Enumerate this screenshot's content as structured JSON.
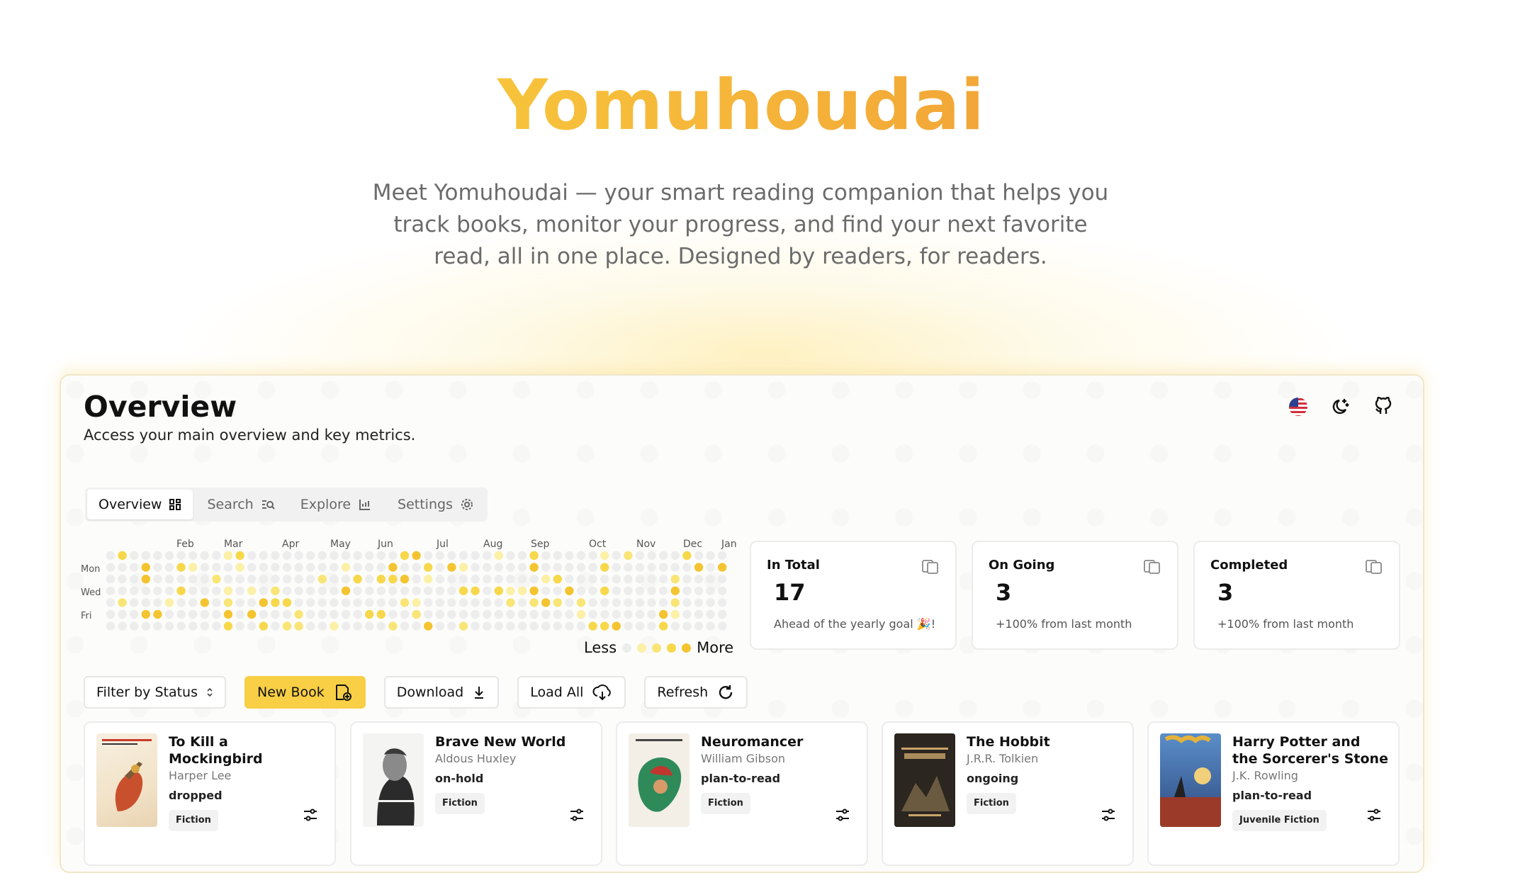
{
  "hero": {
    "title": "Yomuhoudai",
    "description": "Meet Yomuhoudai — your smart reading companion that helps you track books, monitor your progress, and find your next favorite read, all in one place. Designed by readers, for readers."
  },
  "overview": {
    "title": "Overview",
    "subtitle": "Access your main overview and key metrics."
  },
  "tabs": [
    {
      "label": "Overview",
      "icon": "grid-icon",
      "active": true
    },
    {
      "label": "Search",
      "icon": "search-list-icon",
      "active": false
    },
    {
      "label": "Explore",
      "icon": "explore-icon",
      "active": false
    },
    {
      "label": "Settings",
      "icon": "gear-icon",
      "active": false
    }
  ],
  "heatmap": {
    "months": [
      "Feb",
      "Mar",
      "Apr",
      "May",
      "Jun",
      "Jul",
      "Aug",
      "Sep",
      "Oct",
      "Nov",
      "Dec",
      "Jan"
    ],
    "days": [
      "Mon",
      "Wed",
      "Fri"
    ],
    "legend_less": "Less",
    "legend_more": "More",
    "colors": [
      "#ededed",
      "#fbf0a6",
      "#f9e576",
      "#f7d84b",
      "#f4c430"
    ]
  },
  "stats": [
    {
      "label": "In Total",
      "value": "17",
      "note": "Ahead of the yearly goal 🎉!"
    },
    {
      "label": "On Going",
      "value": "3",
      "note": "+100% from last month"
    },
    {
      "label": "Completed",
      "value": "3",
      "note": "+100% from last month"
    }
  ],
  "toolbar": {
    "filter_label": "Filter by Status",
    "new_book_label": "New Book",
    "download_label": "Download",
    "load_all_label": "Load All",
    "refresh_label": "Refresh"
  },
  "books": [
    {
      "title": "To Kill a Mockingbird",
      "author": "Harper Lee",
      "status": "dropped",
      "genre": "Fiction"
    },
    {
      "title": "Brave New World",
      "author": "Aldous Huxley",
      "status": "on-hold",
      "genre": "Fiction"
    },
    {
      "title": "Neuromancer",
      "author": "William Gibson",
      "status": "plan-to-read",
      "genre": "Fiction"
    },
    {
      "title": "The Hobbit",
      "author": "J.R.R. Tolkien",
      "status": "ongoing",
      "genre": "Fiction"
    },
    {
      "title": "Harry Potter and the Sorcerer's Stone",
      "author": "J.K. Rowling",
      "status": "plan-to-read",
      "genre": "Juvenile Fiction"
    }
  ]
}
